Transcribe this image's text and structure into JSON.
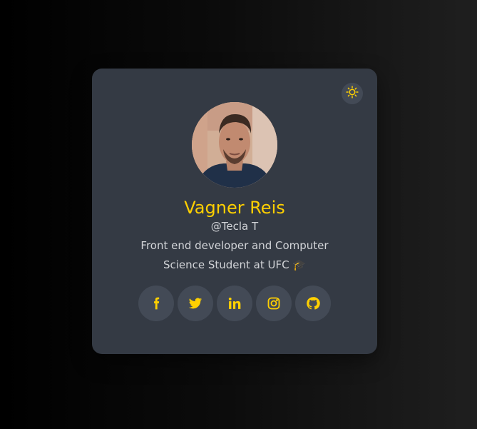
{
  "profile": {
    "name": "Vagner Reis",
    "handle": "@Tecla T",
    "bio": "Front end developer and Computer Science Student at UFC 🎓"
  },
  "theme_toggle": {
    "icon": "sun-icon"
  },
  "socials": [
    {
      "name": "facebook",
      "icon": "facebook-icon"
    },
    {
      "name": "twitter",
      "icon": "twitter-icon"
    },
    {
      "name": "linkedin",
      "icon": "linkedin-icon"
    },
    {
      "name": "instagram",
      "icon": "instagram-icon"
    },
    {
      "name": "github",
      "icon": "github-icon"
    }
  ],
  "colors": {
    "accent": "#ffd000",
    "card_background": "#343a44",
    "button_background": "#434a56",
    "text": "#d2d4d8"
  }
}
